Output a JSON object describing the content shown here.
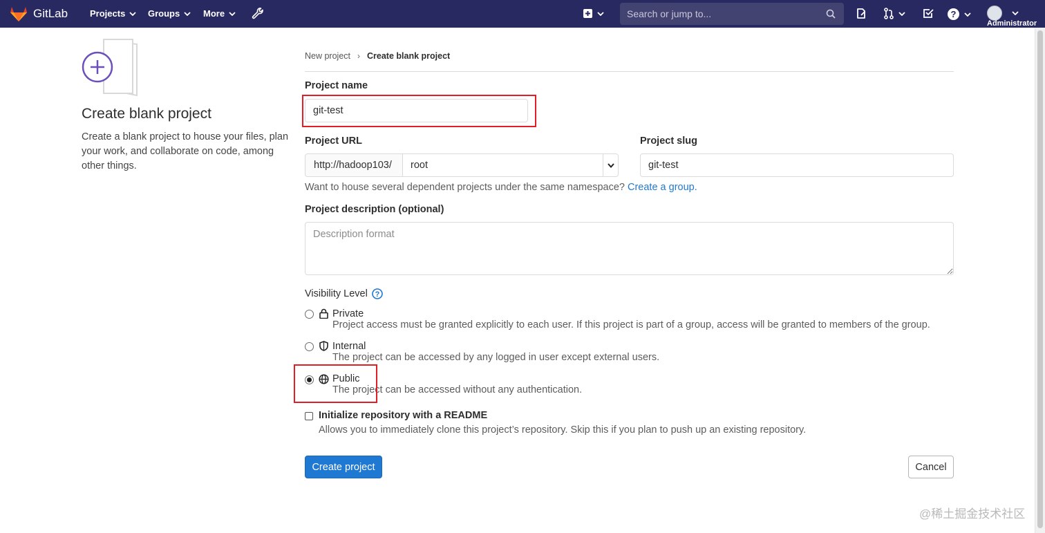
{
  "navbar": {
    "brand": "GitLab",
    "projects": "Projects",
    "groups": "Groups",
    "more": "More",
    "search_placeholder": "Search or jump to...",
    "user_name": "Administrator"
  },
  "intro": {
    "title": "Create blank project",
    "description": "Create a blank project to house your files, plan your work, and collaborate on code, among other things."
  },
  "breadcrumb": {
    "parent": "New project",
    "current": "Create blank project"
  },
  "form": {
    "project_name_label": "Project name",
    "project_name_value": "git-test",
    "project_url_label": "Project URL",
    "url_prefix": "http://hadoop103/",
    "namespace": "root",
    "project_slug_label": "Project slug",
    "project_slug_value": "git-test",
    "namespace_help": "Want to house several dependent projects under the same namespace?",
    "create_group_link": "Create a group.",
    "description_label": "Project description (optional)",
    "description_placeholder": "Description format",
    "visibility_label": "Visibility Level",
    "visibility_options": [
      {
        "name": "Private",
        "description": "Project access must be granted explicitly to each user. If this project is part of a group, access will be granted to members of the group.",
        "checked": false
      },
      {
        "name": "Internal",
        "description": "The project can be accessed by any logged in user except external users.",
        "checked": false
      },
      {
        "name": "Public",
        "description": "The project can be accessed without any authentication.",
        "checked": true
      }
    ],
    "readme_label": "Initialize repository with a README",
    "readme_description": "Allows you to immediately clone this project’s repository. Skip this if you plan to push up an existing repository.",
    "readme_checked": false,
    "create_button": "Create project",
    "cancel_button": "Cancel"
  },
  "watermark": "@稀土掘金技术社区",
  "colors": {
    "navbar": "#292961",
    "primary": "#1f78d1",
    "highlight": "#e01e26"
  }
}
